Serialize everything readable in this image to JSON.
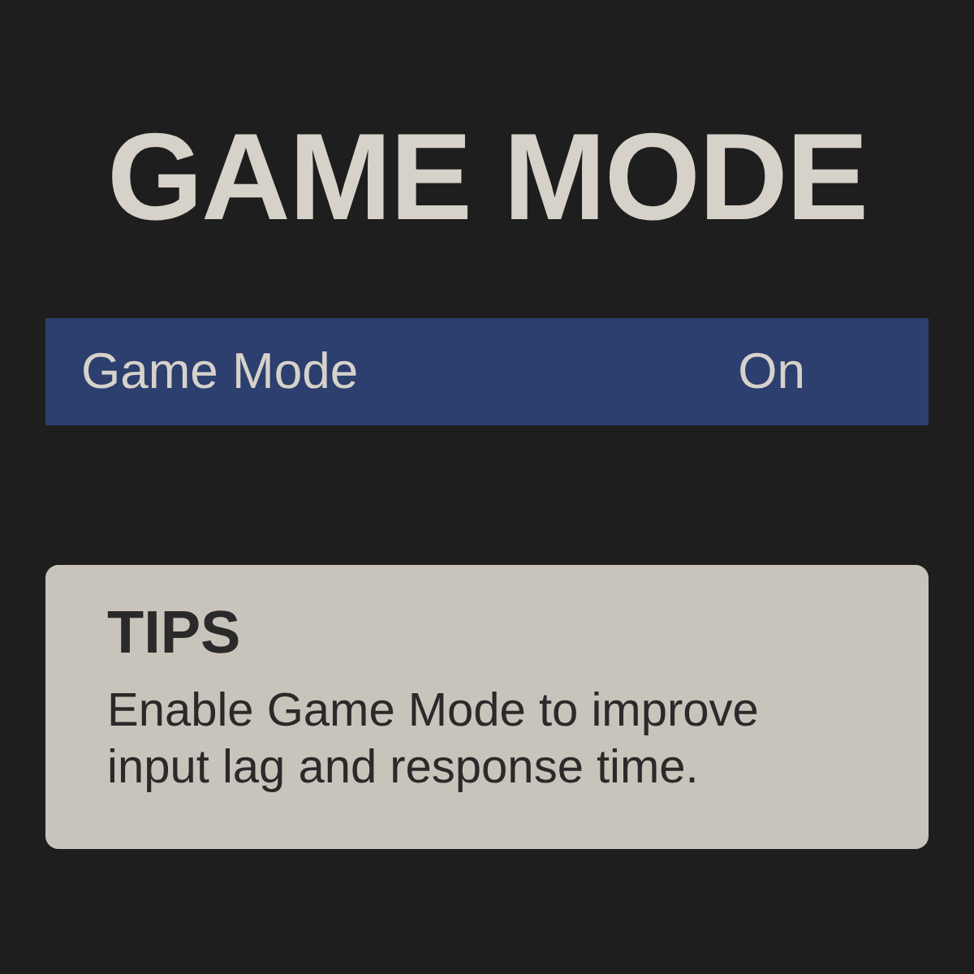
{
  "title": "GAME MODE",
  "settings": [
    {
      "label": "Game Mode",
      "value": "On",
      "selected": true
    }
  ],
  "tips": {
    "heading": "TIPS",
    "text": "Enable Game Mode to improve input lag and response time."
  }
}
